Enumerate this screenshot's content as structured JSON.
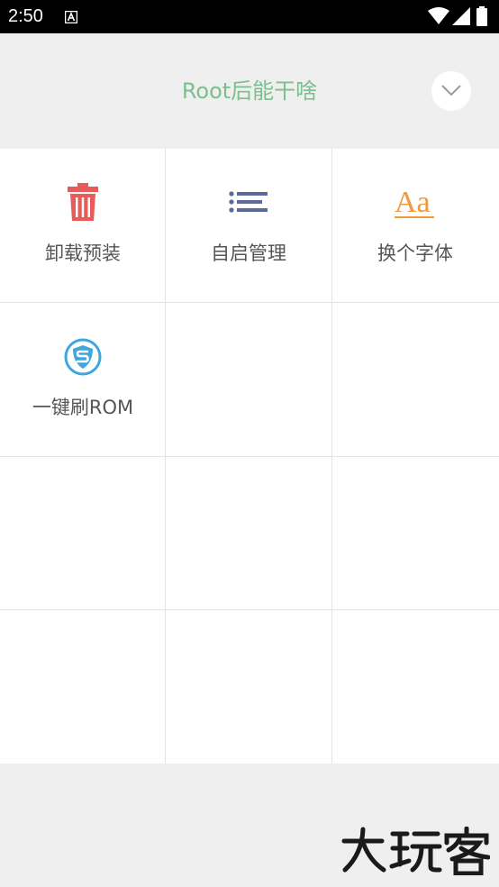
{
  "status_bar": {
    "time": "2:50",
    "notification_icon": "a-letter-icon",
    "wifi_icon": "wifi-icon",
    "signal_icon": "cellular-signal-icon",
    "battery_icon": "battery-icon"
  },
  "header": {
    "title": "Root后能干啥",
    "collapse_icon": "chevron-down-icon",
    "title_color": "#7cbf8e"
  },
  "grid": {
    "items": [
      {
        "label": "卸载预装",
        "icon": "trash-icon",
        "color": "#e85b5b"
      },
      {
        "label": "自启管理",
        "icon": "list-icon",
        "color": "#5a6a9a"
      },
      {
        "label": "换个字体",
        "icon": "font-icon",
        "color": "#ef9a3c"
      },
      {
        "label": "一键刷ROM",
        "icon": "shield-icon",
        "color": "#3fa7dd"
      }
    ]
  },
  "watermark": {
    "text": "大玩客"
  }
}
